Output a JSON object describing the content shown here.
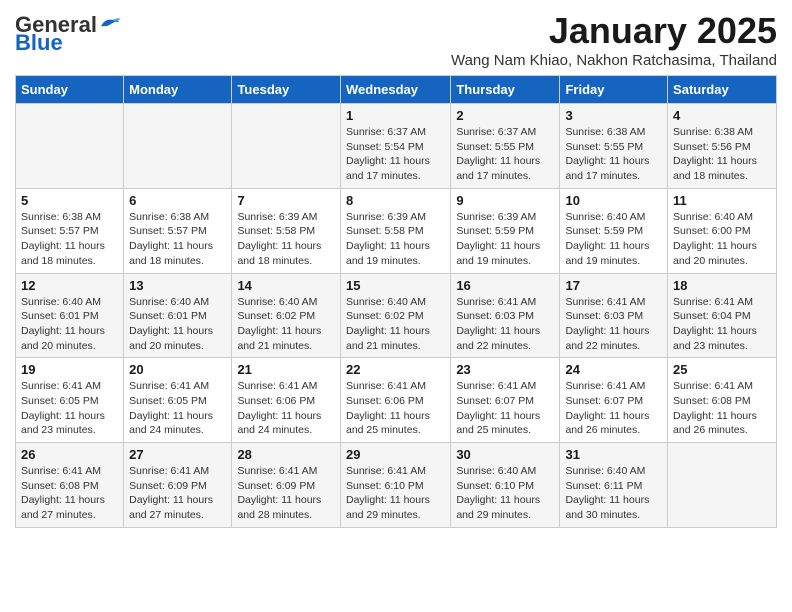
{
  "logo": {
    "general": "General",
    "blue": "Blue"
  },
  "title": "January 2025",
  "location": "Wang Nam Khiao, Nakhon Ratchasima, Thailand",
  "headers": [
    "Sunday",
    "Monday",
    "Tuesday",
    "Wednesday",
    "Thursday",
    "Friday",
    "Saturday"
  ],
  "weeks": [
    [
      {
        "day": "",
        "info": ""
      },
      {
        "day": "",
        "info": ""
      },
      {
        "day": "",
        "info": ""
      },
      {
        "day": "1",
        "info": "Sunrise: 6:37 AM\nSunset: 5:54 PM\nDaylight: 11 hours and 17 minutes."
      },
      {
        "day": "2",
        "info": "Sunrise: 6:37 AM\nSunset: 5:55 PM\nDaylight: 11 hours and 17 minutes."
      },
      {
        "day": "3",
        "info": "Sunrise: 6:38 AM\nSunset: 5:55 PM\nDaylight: 11 hours and 17 minutes."
      },
      {
        "day": "4",
        "info": "Sunrise: 6:38 AM\nSunset: 5:56 PM\nDaylight: 11 hours and 18 minutes."
      }
    ],
    [
      {
        "day": "5",
        "info": "Sunrise: 6:38 AM\nSunset: 5:57 PM\nDaylight: 11 hours and 18 minutes."
      },
      {
        "day": "6",
        "info": "Sunrise: 6:38 AM\nSunset: 5:57 PM\nDaylight: 11 hours and 18 minutes."
      },
      {
        "day": "7",
        "info": "Sunrise: 6:39 AM\nSunset: 5:58 PM\nDaylight: 11 hours and 18 minutes."
      },
      {
        "day": "8",
        "info": "Sunrise: 6:39 AM\nSunset: 5:58 PM\nDaylight: 11 hours and 19 minutes."
      },
      {
        "day": "9",
        "info": "Sunrise: 6:39 AM\nSunset: 5:59 PM\nDaylight: 11 hours and 19 minutes."
      },
      {
        "day": "10",
        "info": "Sunrise: 6:40 AM\nSunset: 5:59 PM\nDaylight: 11 hours and 19 minutes."
      },
      {
        "day": "11",
        "info": "Sunrise: 6:40 AM\nSunset: 6:00 PM\nDaylight: 11 hours and 20 minutes."
      }
    ],
    [
      {
        "day": "12",
        "info": "Sunrise: 6:40 AM\nSunset: 6:01 PM\nDaylight: 11 hours and 20 minutes."
      },
      {
        "day": "13",
        "info": "Sunrise: 6:40 AM\nSunset: 6:01 PM\nDaylight: 11 hours and 20 minutes."
      },
      {
        "day": "14",
        "info": "Sunrise: 6:40 AM\nSunset: 6:02 PM\nDaylight: 11 hours and 21 minutes."
      },
      {
        "day": "15",
        "info": "Sunrise: 6:40 AM\nSunset: 6:02 PM\nDaylight: 11 hours and 21 minutes."
      },
      {
        "day": "16",
        "info": "Sunrise: 6:41 AM\nSunset: 6:03 PM\nDaylight: 11 hours and 22 minutes."
      },
      {
        "day": "17",
        "info": "Sunrise: 6:41 AM\nSunset: 6:03 PM\nDaylight: 11 hours and 22 minutes."
      },
      {
        "day": "18",
        "info": "Sunrise: 6:41 AM\nSunset: 6:04 PM\nDaylight: 11 hours and 23 minutes."
      }
    ],
    [
      {
        "day": "19",
        "info": "Sunrise: 6:41 AM\nSunset: 6:05 PM\nDaylight: 11 hours and 23 minutes."
      },
      {
        "day": "20",
        "info": "Sunrise: 6:41 AM\nSunset: 6:05 PM\nDaylight: 11 hours and 24 minutes."
      },
      {
        "day": "21",
        "info": "Sunrise: 6:41 AM\nSunset: 6:06 PM\nDaylight: 11 hours and 24 minutes."
      },
      {
        "day": "22",
        "info": "Sunrise: 6:41 AM\nSunset: 6:06 PM\nDaylight: 11 hours and 25 minutes."
      },
      {
        "day": "23",
        "info": "Sunrise: 6:41 AM\nSunset: 6:07 PM\nDaylight: 11 hours and 25 minutes."
      },
      {
        "day": "24",
        "info": "Sunrise: 6:41 AM\nSunset: 6:07 PM\nDaylight: 11 hours and 26 minutes."
      },
      {
        "day": "25",
        "info": "Sunrise: 6:41 AM\nSunset: 6:08 PM\nDaylight: 11 hours and 26 minutes."
      }
    ],
    [
      {
        "day": "26",
        "info": "Sunrise: 6:41 AM\nSunset: 6:08 PM\nDaylight: 11 hours and 27 minutes."
      },
      {
        "day": "27",
        "info": "Sunrise: 6:41 AM\nSunset: 6:09 PM\nDaylight: 11 hours and 27 minutes."
      },
      {
        "day": "28",
        "info": "Sunrise: 6:41 AM\nSunset: 6:09 PM\nDaylight: 11 hours and 28 minutes."
      },
      {
        "day": "29",
        "info": "Sunrise: 6:41 AM\nSunset: 6:10 PM\nDaylight: 11 hours and 29 minutes."
      },
      {
        "day": "30",
        "info": "Sunrise: 6:40 AM\nSunset: 6:10 PM\nDaylight: 11 hours and 29 minutes."
      },
      {
        "day": "31",
        "info": "Sunrise: 6:40 AM\nSunset: 6:11 PM\nDaylight: 11 hours and 30 minutes."
      },
      {
        "day": "",
        "info": ""
      }
    ]
  ]
}
